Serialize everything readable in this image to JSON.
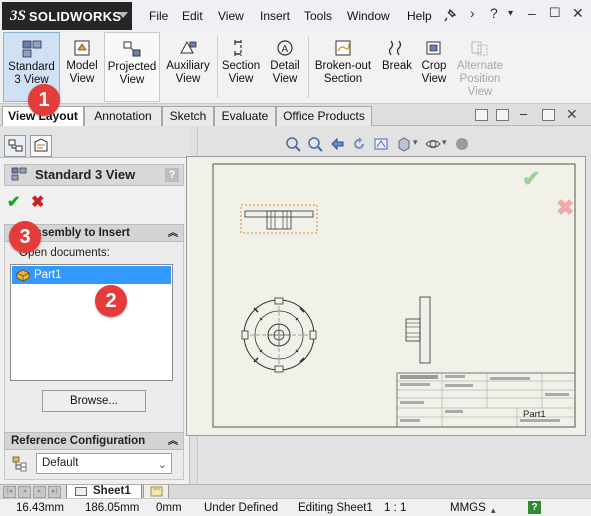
{
  "app": {
    "logo_mark": "3S",
    "logo_name": "SOLIDWORKS"
  },
  "menu": [
    "File",
    "Edit",
    "View",
    "Insert",
    "Tools",
    "Window",
    "Help"
  ],
  "ribbon": {
    "buttons": [
      {
        "line1": "Standard",
        "line2": "3 View",
        "line3": ""
      },
      {
        "line1": "Model",
        "line2": "View",
        "line3": ""
      },
      {
        "line1": "Projected",
        "line2": "View",
        "line3": ""
      },
      {
        "line1": "Auxiliary",
        "line2": "View",
        "line3": ""
      },
      {
        "line1": "Section",
        "line2": "View",
        "line3": ""
      },
      {
        "line1": "Detail",
        "line2": "View",
        "line3": ""
      },
      {
        "line1": "Broken-out",
        "line2": "Section",
        "line3": ""
      },
      {
        "line1": "Break",
        "line2": "",
        "line3": ""
      },
      {
        "line1": "Crop",
        "line2": "View",
        "line3": ""
      },
      {
        "line1": "Alternate",
        "line2": "Position",
        "line3": "View"
      }
    ]
  },
  "tabs": [
    "View Layout",
    "Annotation",
    "Sketch",
    "Evaluate",
    "Office Products"
  ],
  "property_manager": {
    "title": "Standard 3 View",
    "help": "?",
    "group1": {
      "title": "Assembly to Insert",
      "open_label": "Open documents:",
      "items": [
        "Part1"
      ],
      "browse": "Browse..."
    },
    "group2": {
      "title": "Reference Configuration",
      "value": "Default"
    }
  },
  "title_block": {
    "part_name": "Part1"
  },
  "sheet_tabs": {
    "active": "Sheet1"
  },
  "status": {
    "x": "16.43mm",
    "y": "186.05mm",
    "z": "0mm",
    "state": "Under Defined",
    "editing": "Editing Sheet1",
    "scale": "1 : 1",
    "units": "MMGS",
    "help": "?"
  },
  "callouts": [
    "1",
    "2",
    "3"
  ],
  "colors": {
    "accent": "#3399ff",
    "callout": "#e53b3b",
    "ok": "#1f9e1f",
    "cancel": "#cc1f1f",
    "sheet": "#f1f1ea"
  }
}
